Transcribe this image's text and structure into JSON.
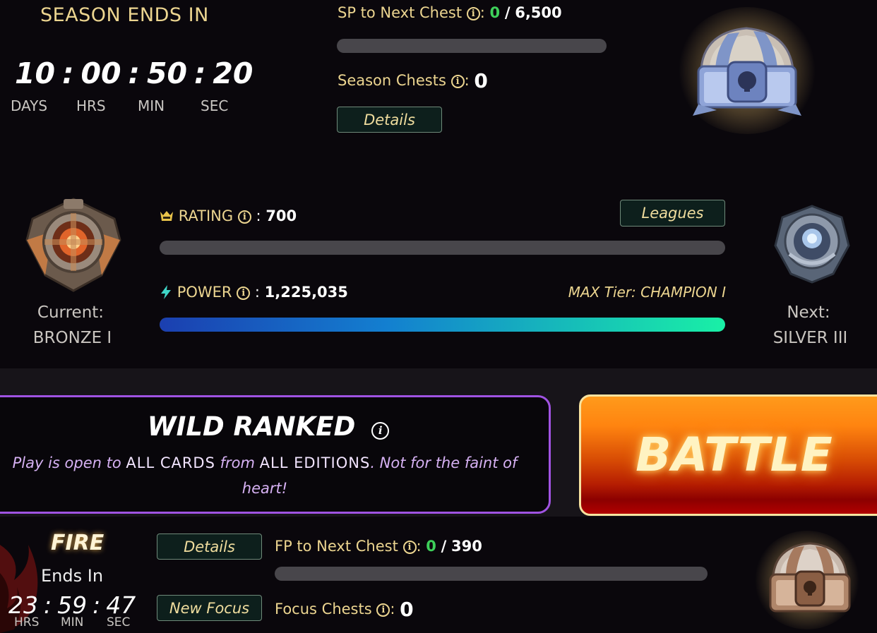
{
  "season": {
    "title": "SEASON ENDS IN",
    "timer": {
      "days": "10",
      "hrs": "00",
      "min": "50",
      "sec": "20"
    },
    "units": {
      "days": "DAYS",
      "hrs": "HRS",
      "min": "MIN",
      "sec": "SEC"
    },
    "sp_label": "SP to Next Chest",
    "sp_current": "0",
    "sp_separator": "/",
    "sp_target": "6,500",
    "sp_progress": 0,
    "chests_label": "Season Chests",
    "chests_value": "0",
    "details_label": "Details"
  },
  "rank": {
    "rating_label": "RATING",
    "rating_value": "700",
    "rating_progress": 0,
    "leagues_label": "Leagues",
    "power_label": "POWER",
    "power_value": "1,225,035",
    "power_progress": 1.0,
    "max_tier": "MAX Tier: CHAMPION I",
    "current_label": "Current:",
    "current_value": "BRONZE I",
    "next_label": "Next:",
    "next_value": "SILVER III"
  },
  "mode": {
    "title": "WILD RANKED",
    "desc_1": "Play is open to",
    "desc_2": "ALL CARDS",
    "desc_3": "from",
    "desc_4": "ALL EDITIONS",
    "desc_5": ". Not for the faint of heart!",
    "battle_label": "BATTLE"
  },
  "focus": {
    "element": "FIRE",
    "ends_in": "Ends In",
    "timer": {
      "hrs": "23",
      "min": "59",
      "sec": "47"
    },
    "units": {
      "hrs": "HRS",
      "min": "MIN",
      "sec": "SEC"
    },
    "details_label": "Details",
    "new_focus_label": "New Focus",
    "fp_label": "FP to Next Chest",
    "fp_current": "0",
    "fp_separator": "/",
    "fp_target": "390",
    "fp_progress": 0,
    "chests_label": "Focus Chests",
    "chests_value": "0"
  },
  "colors": {
    "gold": "#ecd590",
    "green": "#3ed05a",
    "purple_border": "#a053e2",
    "battle_orange": "#ff8410",
    "power_gradient_start": "#1b3fb0",
    "power_gradient_end": "#19f0a6"
  },
  "icons": {
    "info": "info-circle-icon",
    "rating": "rating-crown-icon",
    "power": "lightning-bolt-icon",
    "current_rank": "bronze-league-badge",
    "next_rank": "silver-league-badge",
    "season_chest": "season-chest-image",
    "focus_chest": "focus-chest-image",
    "fire": "fire-flame-icon"
  }
}
